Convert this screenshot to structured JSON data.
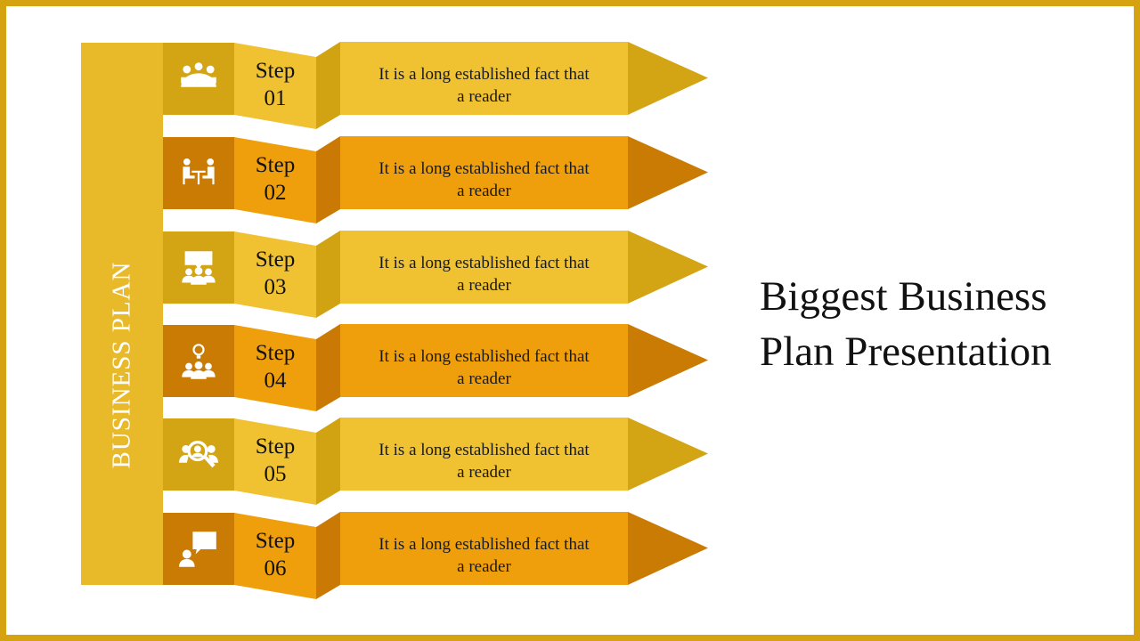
{
  "slide": {
    "sidebar_label": "BUSINESS PLAN",
    "title_line1": "Biggest Business",
    "title_line2": "Plan Presentation",
    "colors": {
      "frame": "#d4a30f",
      "sidebar": "#e8b928",
      "light": {
        "icon_box": "#d3a414",
        "panel": "#f0c232",
        "fold": "#d1a313",
        "tip": "#d3a414"
      },
      "dark": {
        "icon_box": "#c97b04",
        "panel": "#f09f0c",
        "fold": "#c97904",
        "tip": "#c97b04"
      }
    },
    "steps": [
      {
        "label_word": "Step",
        "number": "01",
        "line1": "It is a long established fact that",
        "line2": "a reader",
        "icon": "meeting-table-icon",
        "tone": "light"
      },
      {
        "label_word": "Step",
        "number": "02",
        "line1": "It is a long established fact that",
        "line2": "a reader",
        "icon": "interview-icon",
        "tone": "dark"
      },
      {
        "label_word": "Step",
        "number": "03",
        "line1": "It is a long established fact that",
        "line2": "a reader",
        "icon": "presentation-group-icon",
        "tone": "light"
      },
      {
        "label_word": "Step",
        "number": "04",
        "line1": "It is a long established fact that",
        "line2": "a reader",
        "icon": "team-idea-icon",
        "tone": "dark"
      },
      {
        "label_word": "Step",
        "number": "05",
        "line1": "It is a long established fact that",
        "line2": "a reader",
        "icon": "people-search-icon",
        "tone": "light"
      },
      {
        "label_word": "Step",
        "number": "06",
        "line1": "It is a long established fact that",
        "line2": "a reader",
        "icon": "person-idea-icon",
        "tone": "dark"
      }
    ]
  }
}
